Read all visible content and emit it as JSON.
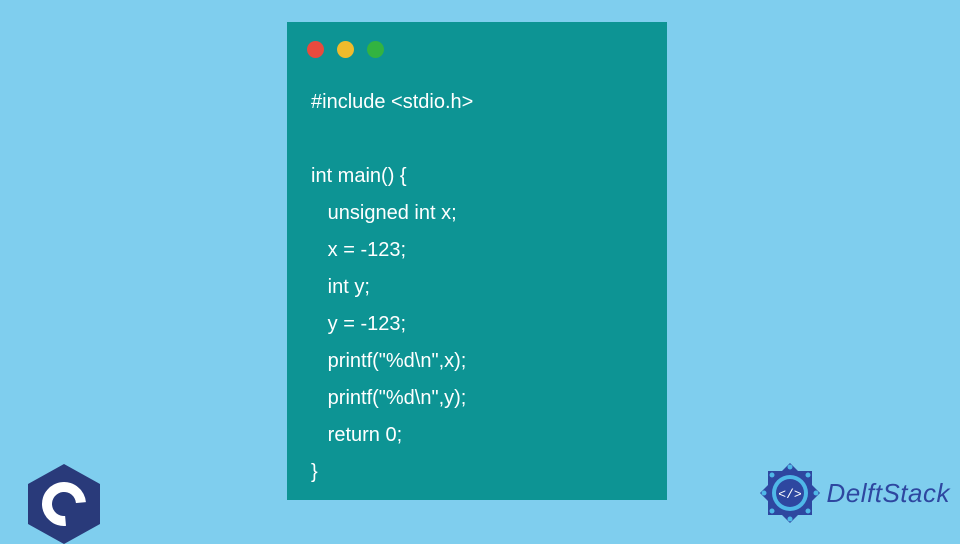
{
  "code": {
    "lines": [
      "#include <stdio.h>",
      "",
      "int main() {",
      "   unsigned int x;",
      "   x = -123;",
      "   int y;",
      "   y = -123;",
      "   printf(\"%d\\n\",x);",
      "   printf(\"%d\\n\",y);",
      "   return 0;",
      "}"
    ]
  },
  "window_controls": {
    "red": "#e84a3e",
    "yellow": "#f0bb2c",
    "green": "#32b341"
  },
  "colors": {
    "background": "#7fceee",
    "code_window": "#0d9494",
    "code_text": "#ffffff",
    "c_logo_hex": "#293a7a",
    "delftstack_blue": "#2e47a0"
  },
  "branding": {
    "site_name": "DelftStack",
    "language_logo": "C"
  }
}
